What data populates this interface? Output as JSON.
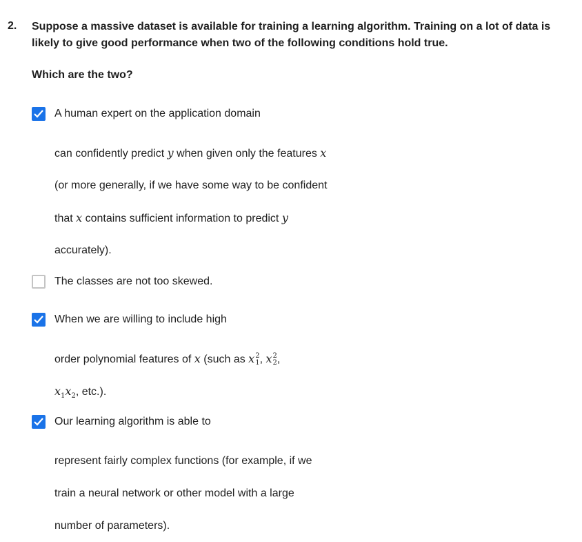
{
  "question": {
    "number": "2.",
    "text": "Suppose a massive dataset is available for training a learning algorithm. Training on a lot of data is likely to give good performance when two of the following conditions hold true.",
    "subprompt": "Which are the two?"
  },
  "options": [
    {
      "checked": true,
      "lines": {
        "l1": "A human expert on the application domain",
        "l2_a": "can confidently predict ",
        "l2_m1": "y",
        "l2_b": " when given only the features ",
        "l2_m2": "x",
        "l3": "(or more generally, if we have some way to be confident",
        "l4_a": "that ",
        "l4_m1": "x",
        "l4_b": " contains sufficient information to predict ",
        "l4_m2": "y",
        "l5": "accurately)."
      }
    },
    {
      "checked": false,
      "lines": {
        "l1": "The classes are not too skewed."
      }
    },
    {
      "checked": true,
      "lines": {
        "l1": "When we are willing to include high",
        "l2_a": "order polynomial features of ",
        "l2_m1": "x",
        "l2_b": " (such as ",
        "l2_m2": "x",
        "l2_s1sup": "2",
        "l2_s1sub": "1",
        "l2_c": ", ",
        "l2_m3": "x",
        "l2_s2sup": "2",
        "l2_s2sub": "2",
        "l2_d": ",",
        "l3_m1": "x",
        "l3_s1": "1",
        "l3_m2": "x",
        "l3_s2": "2",
        "l3_b": ", etc.)."
      }
    },
    {
      "checked": true,
      "lines": {
        "l1": "Our learning algorithm is able to",
        "l2": "represent fairly complex functions (for example, if we",
        "l3": "train a neural network or other model with a large",
        "l4": "number of parameters)."
      }
    }
  ]
}
